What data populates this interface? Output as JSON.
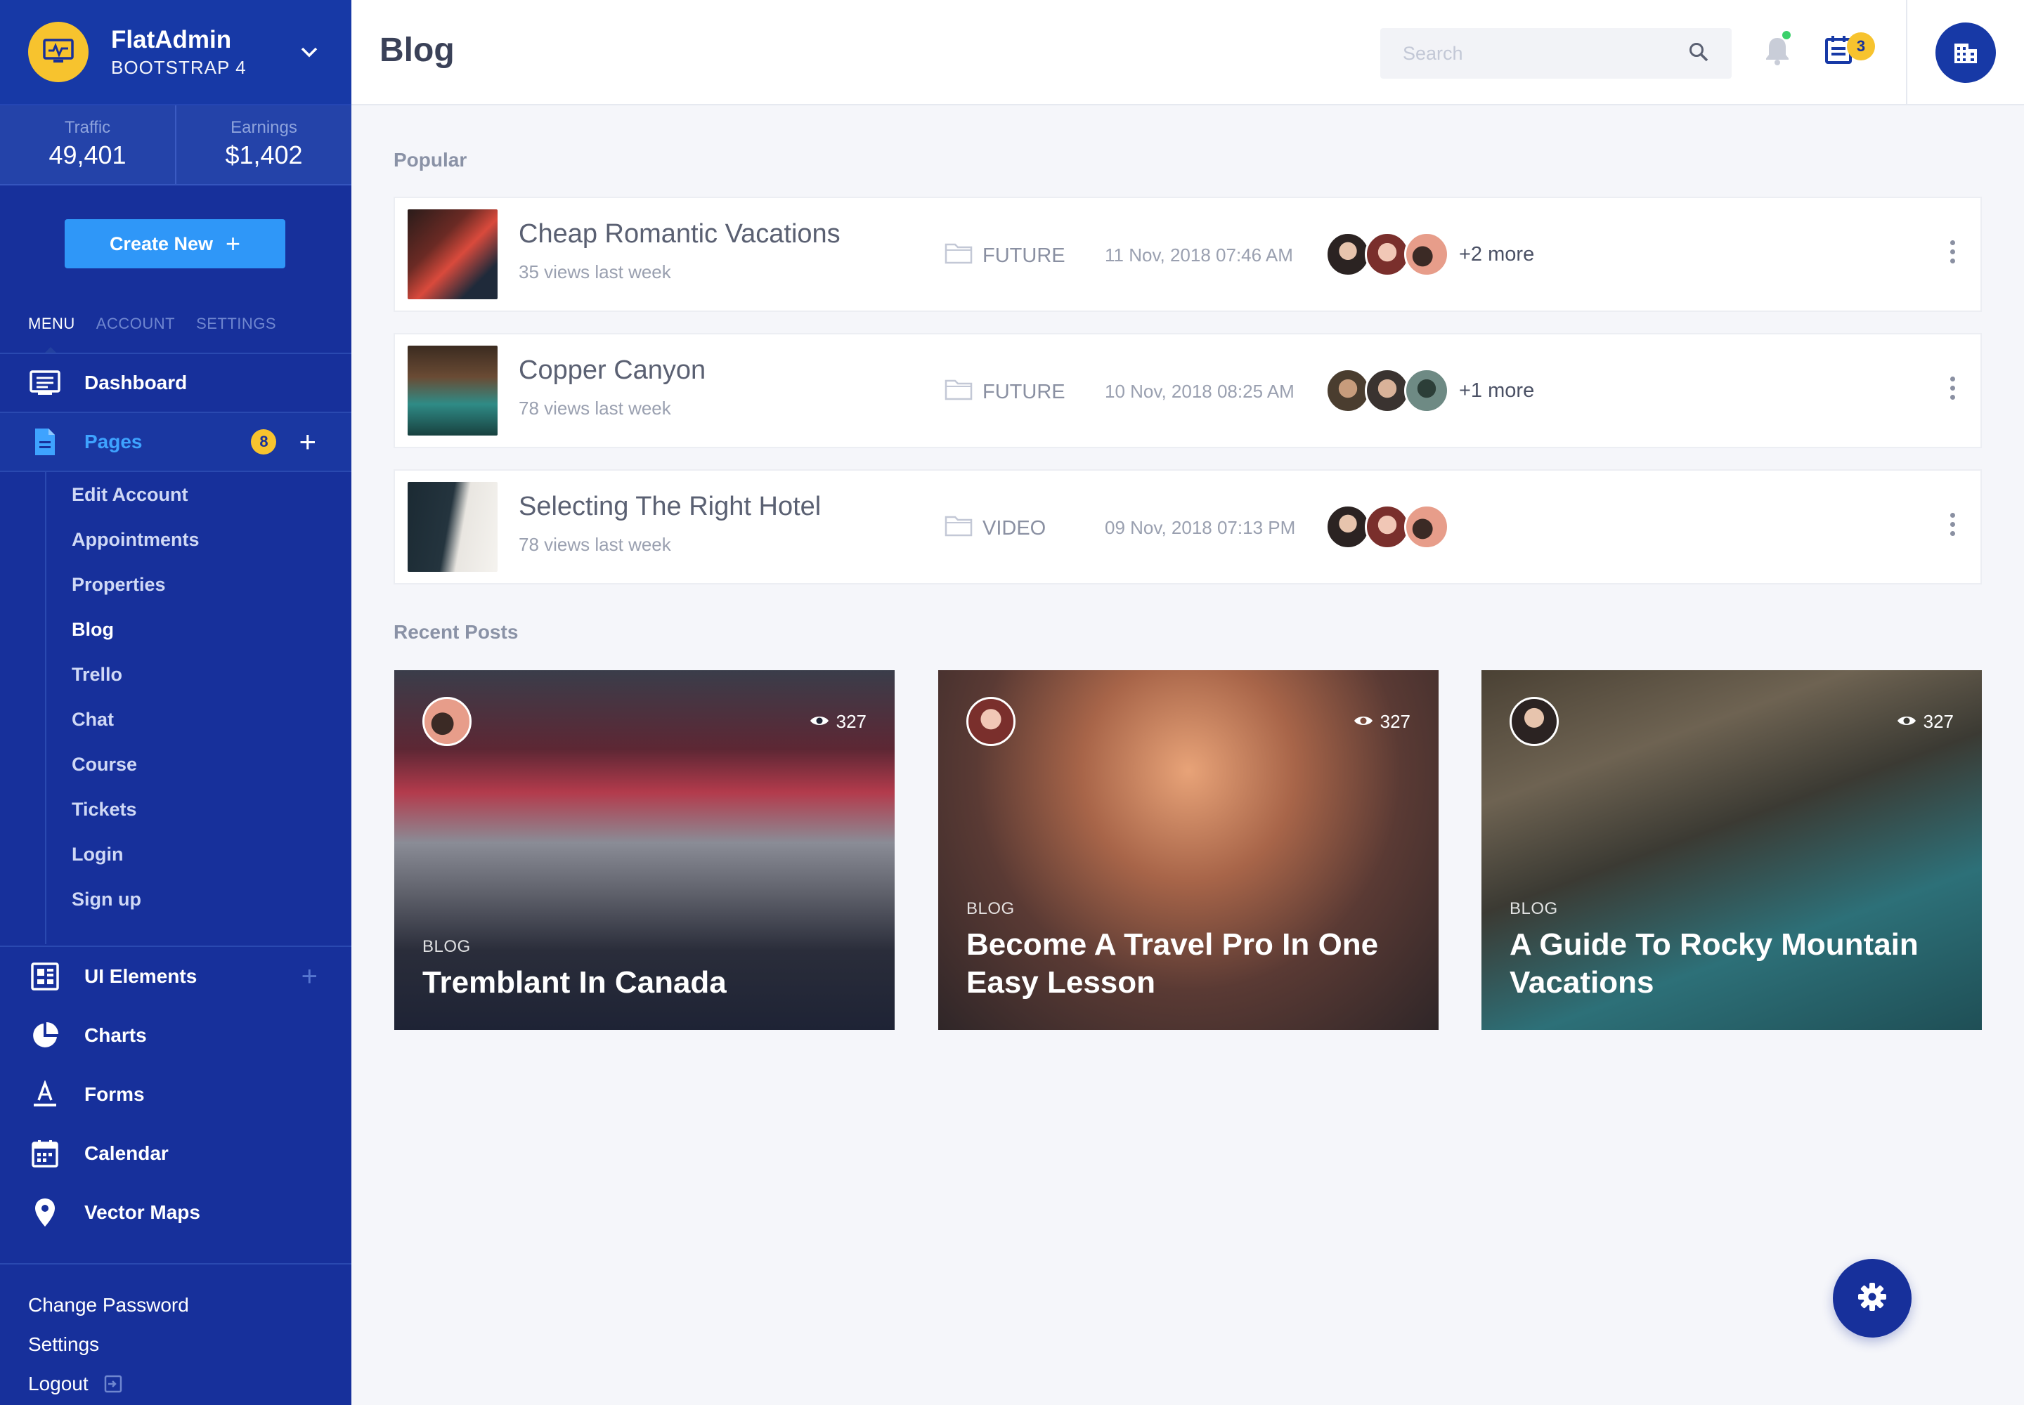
{
  "brand": {
    "name": "FlatAdmin",
    "sub": "BOOTSTRAP 4"
  },
  "stats": [
    {
      "label": "Traffic",
      "value": "49,401"
    },
    {
      "label": "Earnings",
      "value": "$1,402"
    }
  ],
  "create_button": "Create New",
  "side_tabs": [
    "MENU",
    "ACCOUNT",
    "SETTINGS"
  ],
  "nav": {
    "dashboard": "Dashboard",
    "pages": "Pages",
    "pages_badge": "8",
    "sub_items": [
      "Edit Account",
      "Appointments",
      "Properties",
      "Blog",
      "Trello",
      "Chat",
      "Course",
      "Tickets",
      "Login",
      "Sign up"
    ],
    "ui_elements": "UI Elements",
    "charts": "Charts",
    "forms": "Forms",
    "calendar": "Calendar",
    "vector_maps": "Vector Maps"
  },
  "footer_links": [
    "Change Password",
    "Settings",
    "Logout"
  ],
  "header": {
    "title": "Blog",
    "search_placeholder": "Search",
    "tasks_badge": "3"
  },
  "popular": {
    "label": "Popular",
    "rows": [
      {
        "title": "Cheap Romantic Vacations",
        "views": "35 views last week",
        "category": "FUTURE",
        "date": "11 Nov, 2018 07:46 AM",
        "more": "+2 more"
      },
      {
        "title": "Copper Canyon",
        "views": "78 views last week",
        "category": "FUTURE",
        "date": "10 Nov, 2018 08:25 AM",
        "more": "+1 more"
      },
      {
        "title": "Selecting The Right Hotel",
        "views": "78 views last week",
        "category": "VIDEO",
        "date": "09 Nov, 2018 07:13 PM",
        "more": ""
      }
    ]
  },
  "recent": {
    "label": "Recent Posts",
    "cards": [
      {
        "tag": "BLOG",
        "title": "Tremblant In Canada",
        "views": "327"
      },
      {
        "tag": "BLOG",
        "title": "Become A Travel Pro In One Easy Lesson",
        "views": "327"
      },
      {
        "tag": "BLOG",
        "title": "A Guide To Rocky Mountain Vacations",
        "views": "327"
      }
    ]
  },
  "colors": {
    "sidebar": "#17309b",
    "accent": "#2f97f8",
    "badge": "#f7c32e"
  }
}
